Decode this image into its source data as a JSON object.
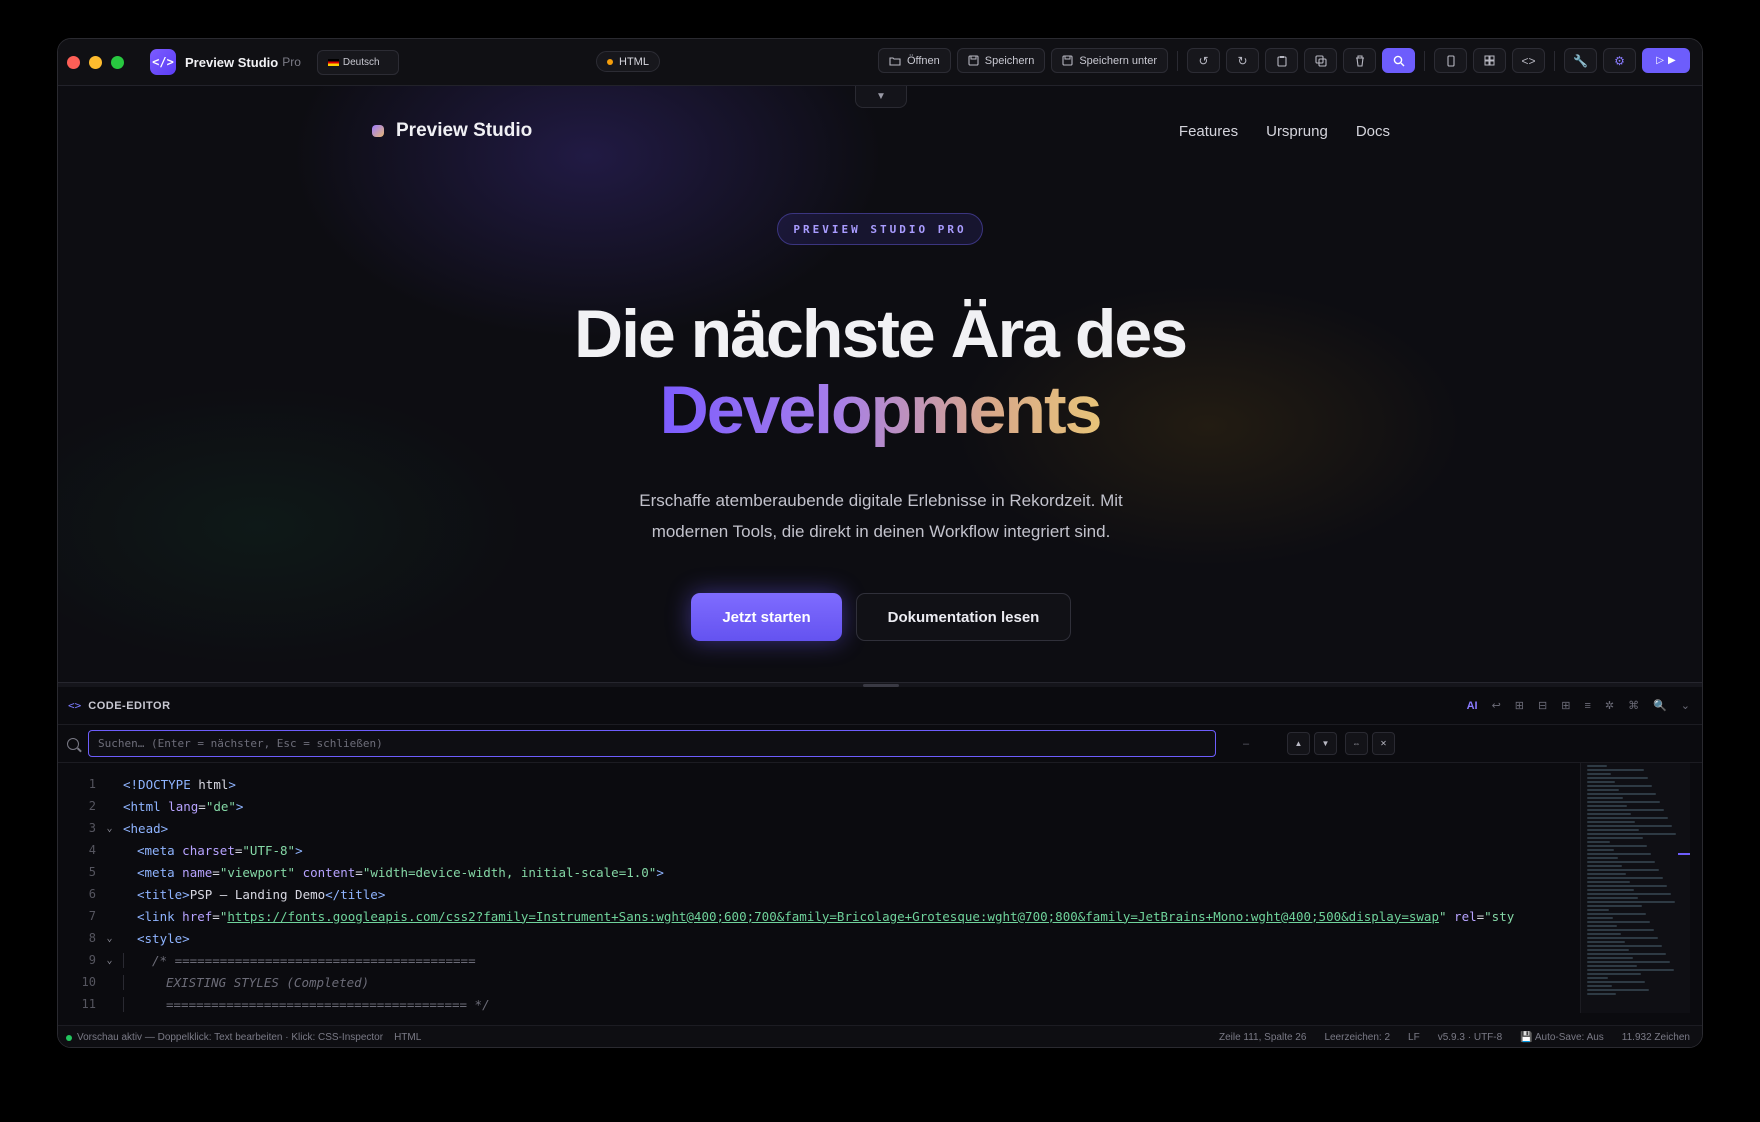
{
  "app": {
    "name": "Preview Studio",
    "edition": "Pro",
    "language": "Deutsch",
    "file_type": "HTML"
  },
  "toolbar": {
    "open_label": "Öffnen",
    "save_label": "Speichern",
    "save_as_label": "Speichern unter"
  },
  "site": {
    "brand": "Preview Studio",
    "nav": [
      "Features",
      "Ursprung",
      "Docs"
    ],
    "badge": "PREVIEW STUDIO PRO",
    "title_line1": "Die nächste Ära des",
    "title_line2": "Developments",
    "subtitle": "Erschaffe atemberaubende digitale Erlebnisse in Rekordzeit. Mit modernen Tools, die direkt in deinen Workflow integriert sind.",
    "cta_primary": "Jetzt starten",
    "cta_secondary": "Dokumentation lesen"
  },
  "editor": {
    "title": "CODE-EDITOR",
    "ai_label": "AI",
    "search_placeholder": "Suchen… (Enter = nächster, Esc = schließen)",
    "search_count": "–",
    "lines": [
      {
        "n": "1",
        "fold": false,
        "indent": 0,
        "html": "<span class='tag'>&lt;!DOCTYPE</span> <span class='txt'>html</span><span class='tag'>&gt;</span>"
      },
      {
        "n": "2",
        "fold": false,
        "indent": 0,
        "html": "<span class='tag'>&lt;html</span> <span class='attr'>lang</span><span class='txt'>=</span><span class='str'>\"de\"</span><span class='tag'>&gt;</span>"
      },
      {
        "n": "3",
        "fold": true,
        "indent": 0,
        "html": "<span class='tag'>&lt;head&gt;</span>"
      },
      {
        "n": "4",
        "fold": false,
        "indent": 1,
        "html": "<span class='tag'>&lt;meta</span> <span class='attr'>charset</span><span class='txt'>=</span><span class='str'>\"UTF-8\"</span><span class='tag'>&gt;</span>"
      },
      {
        "n": "5",
        "fold": false,
        "indent": 1,
        "html": "<span class='tag'>&lt;meta</span> <span class='attr'>name</span><span class='txt'>=</span><span class='str'>\"viewport\"</span> <span class='attr'>content</span><span class='txt'>=</span><span class='str'>\"width=device-width, initial-scale=1.0\"</span><span class='tag'>&gt;</span>"
      },
      {
        "n": "6",
        "fold": false,
        "indent": 1,
        "html": "<span class='tag'>&lt;title&gt;</span><span class='txt'>PSP – Landing Demo</span><span class='tag'>&lt;/title&gt;</span>"
      },
      {
        "n": "7",
        "fold": false,
        "indent": 1,
        "html": "<span class='tag'>&lt;link</span> <span class='attr'>href</span><span class='txt'>=</span><span class='str'>\"</span><span class='url'>https://fonts.googleapis.com/css2?family=Instrument+Sans:wght@400;600;700&amp;family=Bricolage+Grotesque:wght@700;800&amp;family=JetBrains+Mono:wght@400;500&amp;display=swap</span><span class='str'>\"</span> <span class='attr'>rel</span><span class='txt'>=</span><span class='str'>\"sty</span>"
      },
      {
        "n": "8",
        "fold": true,
        "indent": 1,
        "html": "<span class='tag'>&lt;style&gt;</span>"
      },
      {
        "n": "9",
        "fold": true,
        "indent": 2,
        "html": "<span class='cmt'>/* ========================================</span>"
      },
      {
        "n": "10",
        "fold": false,
        "indent": 3,
        "html": "<span class='cmt'>EXISTING STYLES (Completed)</span>"
      },
      {
        "n": "11",
        "fold": false,
        "indent": 3,
        "html": "<span class='cmt'>======================================== */</span>"
      }
    ]
  },
  "status": {
    "left": "Vorschau aktiv — Doppelklick: Text bearbeiten · Klick: CSS-Inspector",
    "file_type": "HTML",
    "position": "Zeile 111, Spalte 26",
    "indent": "Leerzeichen: 2",
    "eol": "LF",
    "version": "v5.9.3 · UTF-8",
    "autosave": "💾 Auto-Save: Aus",
    "chars": "11.932 Zeichen"
  },
  "colors": {
    "accent": "#6d5dfc",
    "background": "#0c0c10"
  },
  "icons": [
    "folder-icon",
    "save-icon",
    "undo-icon",
    "redo-icon",
    "clipboard-icon",
    "copy-icon",
    "trash-icon",
    "search-icon",
    "mobile-icon",
    "grid-icon",
    "code-icon",
    "wrench-icon",
    "gear-icon",
    "play-icon"
  ]
}
